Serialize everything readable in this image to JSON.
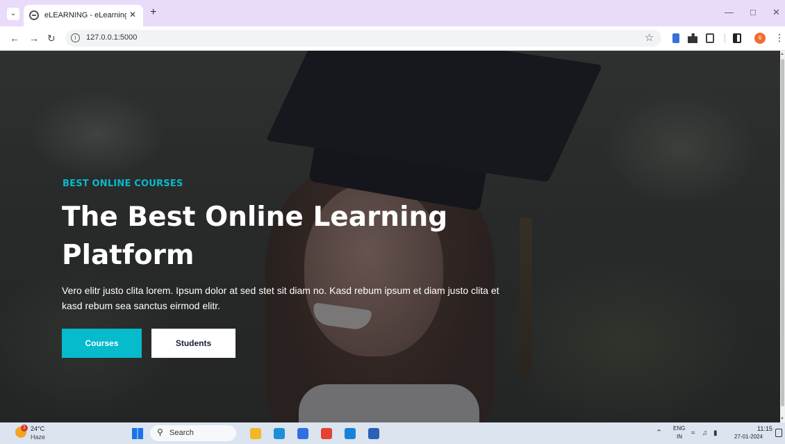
{
  "browser": {
    "tab_title": "eLEARNING - eLearning HTML",
    "url": "127.0.0.1:5000",
    "profile_initial": "6"
  },
  "hero": {
    "kicker": "BEST ONLINE COURSES",
    "headline": "The Best Online Learning Platform",
    "lead": "Vero elitr justo clita lorem. Ipsum dolor at sed stet sit diam no. Kasd rebum ipsum et diam justo clita et kasd rebum sea sanctus eirmod elitr.",
    "primary_button": "Courses",
    "secondary_button": "Students"
  },
  "taskbar": {
    "weather_temp": "24°C",
    "weather_desc": "Haze",
    "weather_badge": "1",
    "search_placeholder": "Search",
    "lang_line1": "ENG",
    "lang_line2": "IN",
    "time": "11:15",
    "date": "27-01-2024",
    "apps": [
      {
        "name": "file-explorer-icon",
        "color": "#f2b826"
      },
      {
        "name": "edge-icon",
        "color": "#1d8fd6"
      },
      {
        "name": "store-icon",
        "color": "#2f6fe0"
      },
      {
        "name": "chrome-icon",
        "color": "#e34133"
      },
      {
        "name": "vscode-icon",
        "color": "#1a82d6"
      },
      {
        "name": "word-icon",
        "color": "#2b5fb8"
      }
    ]
  },
  "colors": {
    "accent": "#06bbcc",
    "tabbar": "#e9dcfb",
    "taskbar": "#dbe4ef"
  }
}
